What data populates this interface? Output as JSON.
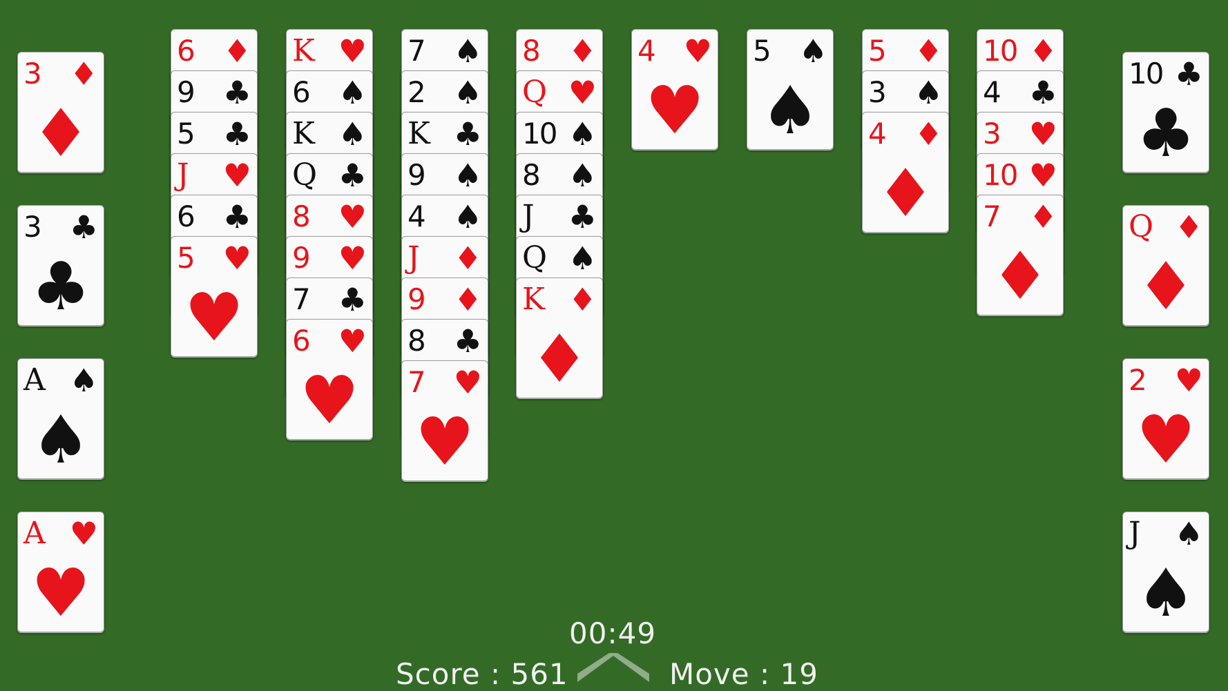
{
  "freecells": [
    {
      "rank": "3",
      "suit": "diamond"
    },
    {
      "rank": "3",
      "suit": "club"
    },
    {
      "rank": "A",
      "suit": "spade"
    },
    {
      "rank": "A",
      "suit": "heart"
    }
  ],
  "foundations": [
    {
      "rank": "10",
      "suit": "club"
    },
    {
      "rank": "Q",
      "suit": "diamond"
    },
    {
      "rank": "2",
      "suit": "heart"
    },
    {
      "rank": "J",
      "suit": "spade"
    }
  ],
  "tableau": [
    [
      {
        "rank": "6",
        "suit": "diamond"
      },
      {
        "rank": "9",
        "suit": "club"
      },
      {
        "rank": "5",
        "suit": "club"
      },
      {
        "rank": "J",
        "suit": "heart"
      },
      {
        "rank": "6",
        "suit": "club"
      },
      {
        "rank": "5",
        "suit": "heart"
      }
    ],
    [
      {
        "rank": "K",
        "suit": "heart"
      },
      {
        "rank": "6",
        "suit": "spade"
      },
      {
        "rank": "K",
        "suit": "spade"
      },
      {
        "rank": "Q",
        "suit": "club"
      },
      {
        "rank": "8",
        "suit": "heart"
      },
      {
        "rank": "9",
        "suit": "heart"
      },
      {
        "rank": "7",
        "suit": "club"
      },
      {
        "rank": "6",
        "suit": "heart"
      }
    ],
    [
      {
        "rank": "7",
        "suit": "spade"
      },
      {
        "rank": "2",
        "suit": "spade"
      },
      {
        "rank": "K",
        "suit": "club"
      },
      {
        "rank": "9",
        "suit": "spade"
      },
      {
        "rank": "4",
        "suit": "spade"
      },
      {
        "rank": "J",
        "suit": "diamond"
      },
      {
        "rank": "9",
        "suit": "diamond"
      },
      {
        "rank": "8",
        "suit": "club"
      },
      {
        "rank": "7",
        "suit": "heart"
      }
    ],
    [
      {
        "rank": "8",
        "suit": "diamond"
      },
      {
        "rank": "Q",
        "suit": "heart"
      },
      {
        "rank": "10",
        "suit": "spade"
      },
      {
        "rank": "8",
        "suit": "spade"
      },
      {
        "rank": "J",
        "suit": "club"
      },
      {
        "rank": "Q",
        "suit": "spade"
      },
      {
        "rank": "K",
        "suit": "diamond"
      }
    ],
    [
      {
        "rank": "4",
        "suit": "heart"
      }
    ],
    [
      {
        "rank": "5",
        "suit": "spade"
      }
    ],
    [
      {
        "rank": "5",
        "suit": "diamond"
      },
      {
        "rank": "3",
        "suit": "spade"
      },
      {
        "rank": "4",
        "suit": "diamond"
      }
    ],
    [
      {
        "rank": "10",
        "suit": "diamond"
      },
      {
        "rank": "4",
        "suit": "club"
      },
      {
        "rank": "3",
        "suit": "heart"
      },
      {
        "rank": "10",
        "suit": "heart"
      },
      {
        "rank": "7",
        "suit": "diamond"
      }
    ]
  ],
  "hud": {
    "timer": "00:49",
    "score_label": "Score : 561",
    "move_label": "Move : 19"
  },
  "colors": {
    "felt": "#336b26",
    "red": "#e8141b",
    "black": "#111111",
    "card": "#fafafa"
  }
}
